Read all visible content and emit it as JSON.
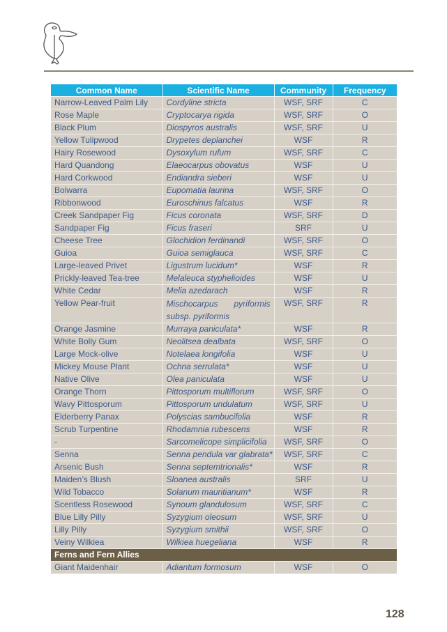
{
  "header": {
    "logo_icon": "kookaburra-bird-icon"
  },
  "table": {
    "columns": [
      "Common Name",
      "Scientific Name",
      "Community",
      "Frequency"
    ],
    "rows": [
      {
        "common": "Narrow-Leaved Palm Lily",
        "scientific": "Cordyline stricta",
        "community": "WSF, SRF",
        "frequency": "C"
      },
      {
        "common": "Rose  Maple",
        "scientific": "Cryptocarya rigida",
        "community": "WSF, SRF",
        "frequency": "O"
      },
      {
        "common": "Black Plum",
        "scientific": "Diospyros australis",
        "community": "WSF, SRF",
        "frequency": "U"
      },
      {
        "common": "Yellow Tulipwood",
        "scientific": "Drypetes deplanchei",
        "community": "WSF",
        "frequency": "R"
      },
      {
        "common": "Hairy Rosewood",
        "scientific": "Dysoxylum rufum",
        "community": "WSF, SRF",
        "frequency": "C"
      },
      {
        "common": "Hard Quandong",
        "scientific": "Elaeocarpus obovatus",
        "community": "WSF",
        "frequency": "U"
      },
      {
        "common": "Hard Corkwood",
        "scientific": "Endiandra sieberi",
        "community": "WSF",
        "frequency": "U"
      },
      {
        "common": "Bolwarra",
        "scientific": "Eupomatia laurina",
        "community": "WSF, SRF",
        "frequency": "O"
      },
      {
        "common": "Ribbonwood",
        "scientific": "Euroschinus falcatus",
        "community": "WSF",
        "frequency": "R"
      },
      {
        "common": "Creek Sandpaper Fig",
        "scientific": "Ficus coronata",
        "community": "WSF, SRF",
        "frequency": "D"
      },
      {
        "common": "Sandpaper Fig",
        "scientific": "Ficus fraseri",
        "community": "SRF",
        "frequency": "U"
      },
      {
        "common": "Cheese Tree",
        "scientific": "Glochidion ferdinandi",
        "community": "WSF, SRF",
        "frequency": "O"
      },
      {
        "common": "Guioa",
        "scientific": "Guioa semiglauca",
        "community": "WSF, SRF",
        "frequency": "C"
      },
      {
        "common": "Large-leaved Privet",
        "scientific": "Ligustrum lucidum*",
        "community": "WSF",
        "frequency": "R"
      },
      {
        "common": "Prickly-leaved Tea-tree",
        "scientific": "Melaleuca styphelioides",
        "community": "WSF",
        "frequency": "U"
      },
      {
        "common": "White Cedar",
        "scientific": "Melia azedarach",
        "community": "WSF",
        "frequency": "R"
      },
      {
        "common": "Yellow Pear-fruit",
        "scientific": "Mischocarpus pyriformis",
        "scientific_line2": "subsp. pyriformis",
        "community": "WSF, SRF",
        "frequency": "R"
      },
      {
        "common": "Orange Jasmine",
        "scientific": "Murraya paniculata*",
        "community": "WSF",
        "frequency": "R"
      },
      {
        "common": "White Bolly Gum",
        "scientific": "Neolitsea dealbata",
        "community": "WSF, SRF",
        "frequency": "O"
      },
      {
        "common": "Large Mock-olive",
        "scientific": "Notelaea longifolia",
        "community": "WSF",
        "frequency": "U"
      },
      {
        "common": "Mickey Mouse Plant",
        "scientific": "Ochna serrulata*",
        "community": "WSF",
        "frequency": "U"
      },
      {
        "common": "Native Olive",
        "scientific": "Olea paniculata",
        "community": "WSF",
        "frequency": "U"
      },
      {
        "common": "Orange Thorn",
        "scientific": "Pittosporum multiflorum",
        "community": "WSF, SRF",
        "frequency": "O"
      },
      {
        "common": "Wavy Pittosporum",
        "scientific": "Pittosporum undulatum",
        "community": "WSF, SRF",
        "frequency": "U"
      },
      {
        "common": "Elderberry Panax",
        "scientific": "Polyscias sambucifolia",
        "community": "WSF",
        "frequency": "R"
      },
      {
        "common": "Scrub Turpentine",
        "scientific": "Rhodamnia rubescens",
        "community": "WSF",
        "frequency": "R"
      },
      {
        "common": "-",
        "scientific": "Sarcomelicope simplicifolia",
        "community": "WSF, SRF",
        "frequency": "O"
      },
      {
        "common": "Senna",
        "scientific": "Senna pendula var glabrata*",
        "community": "WSF, SRF",
        "frequency": "C"
      },
      {
        "common": "Arsenic Bush",
        "scientific": "Senna septemtrionalis*",
        "community": "WSF",
        "frequency": "R"
      },
      {
        "common": "Maiden’s Blush",
        "scientific": "Sloanea australis",
        "community": "SRF",
        "frequency": "U"
      },
      {
        "common": "Wild Tobacco",
        "scientific": "Solanum mauritianum*",
        "community": "WSF",
        "frequency": "R"
      },
      {
        "common": "Scentless Rosewood",
        "scientific": "Synoum glandulosum",
        "community": "WSF, SRF",
        "frequency": "C"
      },
      {
        "common": "Blue Lilly Pilly",
        "scientific": "Syzygium oleosum",
        "community": "WSF, SRF",
        "frequency": "U"
      },
      {
        "common": "Lilly Pilly",
        "scientific": "Syzygium smithii",
        "community": "WSF, SRF",
        "frequency": "O"
      },
      {
        "common": "Veiny Wilkiea",
        "scientific": "Wilkiea huegeliana",
        "community": "WSF",
        "frequency": "R"
      }
    ],
    "section": {
      "title": "Ferns and Fern Allies",
      "rows": [
        {
          "common": "Giant Maidenhair",
          "scientific": "Adiantum formosum",
          "community": "WSF",
          "frequency": "O"
        }
      ]
    }
  },
  "footer": {
    "page_number": "128"
  },
  "colors": {
    "header_bg": "#1ab0e2",
    "row_bg": "#d6d0c7",
    "text": "#3d5a8a",
    "section_bg": "#6b5f48",
    "rule": "#8a8272"
  }
}
